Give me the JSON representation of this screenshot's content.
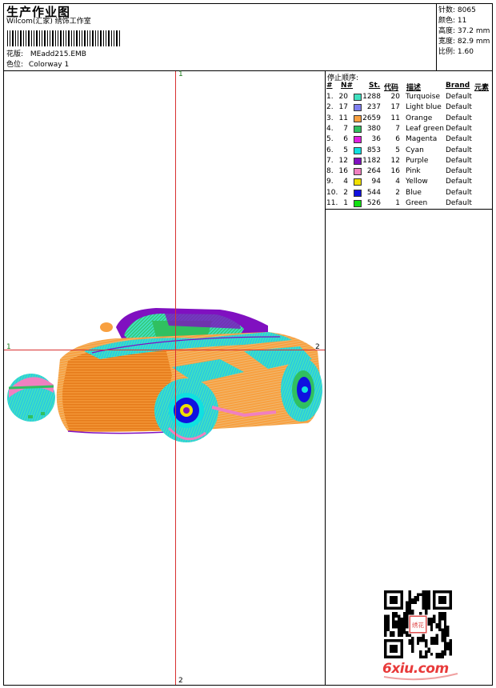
{
  "header": {
    "title": "生产作业图",
    "studio": "Wilcom(汇家) 绣饰工作室",
    "design_label": "花版:",
    "design_value": "MEadd215.EMB",
    "colorway_label": "色位:",
    "colorway_value": "Colorway 1"
  },
  "stats": [
    {
      "label": "针数:",
      "value": "8065"
    },
    {
      "label": "颜色:",
      "value": "11"
    },
    {
      "label": "高度:",
      "value": "37.2 mm"
    },
    {
      "label": "宽度:",
      "value": "82.9 mm"
    },
    {
      "label": "比例:",
      "value": "1.60"
    }
  ],
  "marks": {
    "top": "1",
    "bottom": "2",
    "left": "1",
    "right": "2"
  },
  "sequence": {
    "title": "停止顺序:",
    "headers": {
      "num": "#",
      "no": "N#",
      "st": "St.",
      "code": "代码",
      "desc": "描述",
      "brand": "Brand",
      "elem": "元素"
    },
    "rows": [
      {
        "idx": "1.",
        "no": "20",
        "color": "#40e0c0",
        "st": "1288",
        "code": "20",
        "desc": "Turquoise",
        "brand": "Default"
      },
      {
        "idx": "2.",
        "no": "17",
        "color": "#8080f0",
        "st": "237",
        "code": "17",
        "desc": "Light blue",
        "brand": "Default"
      },
      {
        "idx": "3.",
        "no": "11",
        "color": "#f8a040",
        "st": "2659",
        "code": "11",
        "desc": "Orange",
        "brand": "Default"
      },
      {
        "idx": "4.",
        "no": "7",
        "color": "#30c060",
        "st": "380",
        "code": "7",
        "desc": "Leaf green",
        "brand": "Default"
      },
      {
        "idx": "5.",
        "no": "6",
        "color": "#e020e0",
        "st": "36",
        "code": "6",
        "desc": "Magenta",
        "brand": "Default"
      },
      {
        "idx": "6.",
        "no": "5",
        "color": "#10e0e0",
        "st": "853",
        "code": "5",
        "desc": "Cyan",
        "brand": "Default"
      },
      {
        "idx": "7.",
        "no": "12",
        "color": "#8010c0",
        "st": "1182",
        "code": "12",
        "desc": "Purple",
        "brand": "Default"
      },
      {
        "idx": "8.",
        "no": "16",
        "color": "#f080c0",
        "st": "264",
        "code": "16",
        "desc": "Pink",
        "brand": "Default"
      },
      {
        "idx": "9.",
        "no": "4",
        "color": "#f0e000",
        "st": "94",
        "code": "4",
        "desc": "Yellow",
        "brand": "Default"
      },
      {
        "idx": "10.",
        "no": "2",
        "color": "#1010e0",
        "st": "544",
        "code": "2",
        "desc": "Blue",
        "brand": "Default"
      },
      {
        "idx": "11.",
        "no": "1",
        "color": "#10e010",
        "st": "526",
        "code": "1",
        "desc": "Green",
        "brand": "Default"
      }
    ]
  },
  "watermark": {
    "text": "6xiu.com",
    "seal_text": "绣花"
  }
}
